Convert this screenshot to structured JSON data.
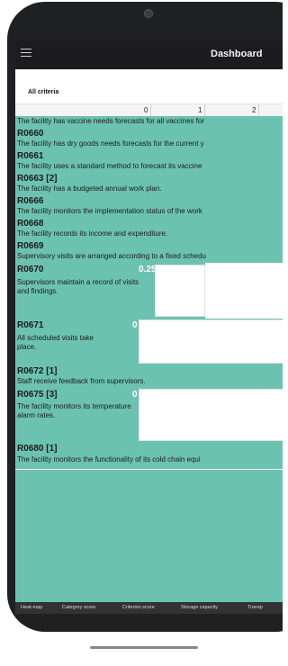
{
  "header": {
    "title": "Dashboard"
  },
  "subheader": "All criteria",
  "axis": {
    "ticks": [
      "0",
      "1",
      "2"
    ]
  },
  "rows": [
    {
      "code": "",
      "description": "The facility has vaccine needs forecasts for all vaccines for"
    },
    {
      "code": "R0660",
      "description": "The facility has dry goods needs forecasts for the current y"
    },
    {
      "code": "R0661",
      "description": "The facility uses a standard method to forecast its vaccine"
    },
    {
      "code": "R0663 [2]",
      "description": "The facility has a budgeted annual work plan."
    },
    {
      "code": "R0666",
      "description": "The facility monitors the implementation status of the work"
    },
    {
      "code": "R0668",
      "description": "The facility records its income and expenditure."
    },
    {
      "code": "R0669",
      "description": "Supervisory visits are arranged according to a fixed schedu"
    },
    {
      "code": "R0670",
      "score": "0.25",
      "description": "Supervisors maintain a record of visits and findings."
    },
    {
      "code": "R0671",
      "score": "0",
      "description": "All scheduled visits take place."
    },
    {
      "code": "R0672 [1]",
      "description": "Staff receive feedback from supervisors."
    },
    {
      "code": "R0675 [3]",
      "score": "0",
      "description": "The facility monitors its temperature alarm rates."
    },
    {
      "code": "R0680 [1]",
      "description": "The facility monitors the functionality of its cold chain equi"
    }
  ],
  "tabs": [
    "Heat-map",
    "Category score",
    "Criterion score",
    "Storage capacity",
    "Transp"
  ]
}
